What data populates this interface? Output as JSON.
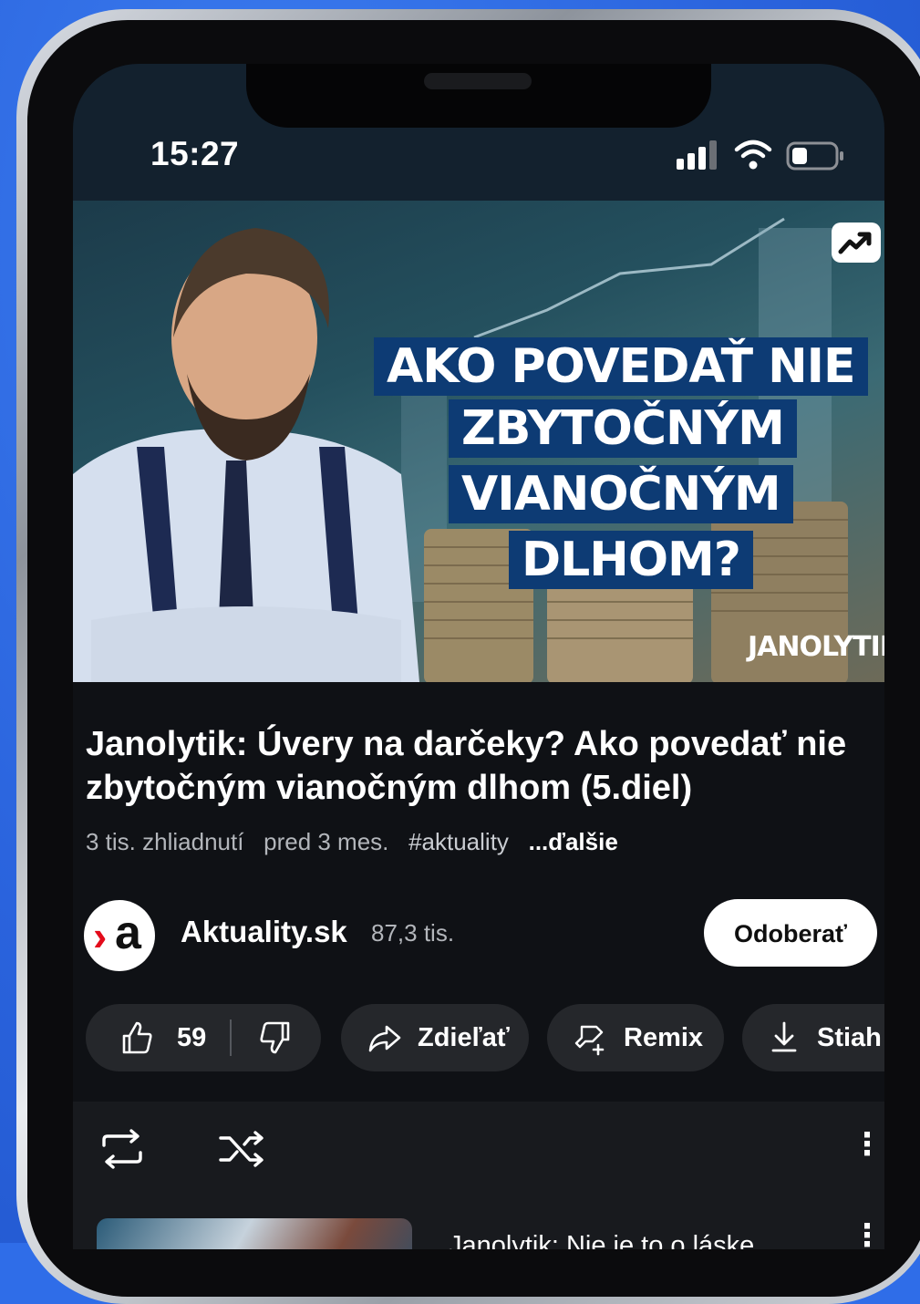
{
  "status_bar": {
    "time": "15:27",
    "icons": [
      "cellular-signal-icon",
      "wifi-icon",
      "battery-icon"
    ]
  },
  "video": {
    "thumbnail": {
      "headline_lines": [
        "AKO POVEDAŤ NIE",
        "ZBYTOČNÝM",
        "VIANOČNÝM",
        "DLHOM?"
      ],
      "brand": "JANOLYTIK",
      "badge_icon": "trending-icon"
    },
    "title": "Janolytik: Úvery na darčeky? Ako povedať nie zbytočným vianočným dlhom (5.diel)",
    "views": "3 tis. zhliadnutí",
    "age": "pred 3 mes.",
    "hashtag": "#aktuality",
    "more": "...ďalšie"
  },
  "channel": {
    "name": "Aktuality.sk",
    "subscribers": "87,3 tis.",
    "subscribe_label": "Odoberať",
    "avatar": {
      "chevron": "›",
      "letter": "a"
    }
  },
  "actions": {
    "like_count": "59",
    "share_label": "Zdieľať",
    "remix_label": "Remix",
    "download_label": "Stiah"
  },
  "queue": {
    "next_title": "Janolytik: Nie je to o láske"
  },
  "colors": {
    "background_blue": "#2f6de8",
    "headline_bg": "#0d3b74",
    "pill_bg": "#25272b",
    "screen_bg": "#0f1115",
    "brand_red": "#e30b1b"
  }
}
